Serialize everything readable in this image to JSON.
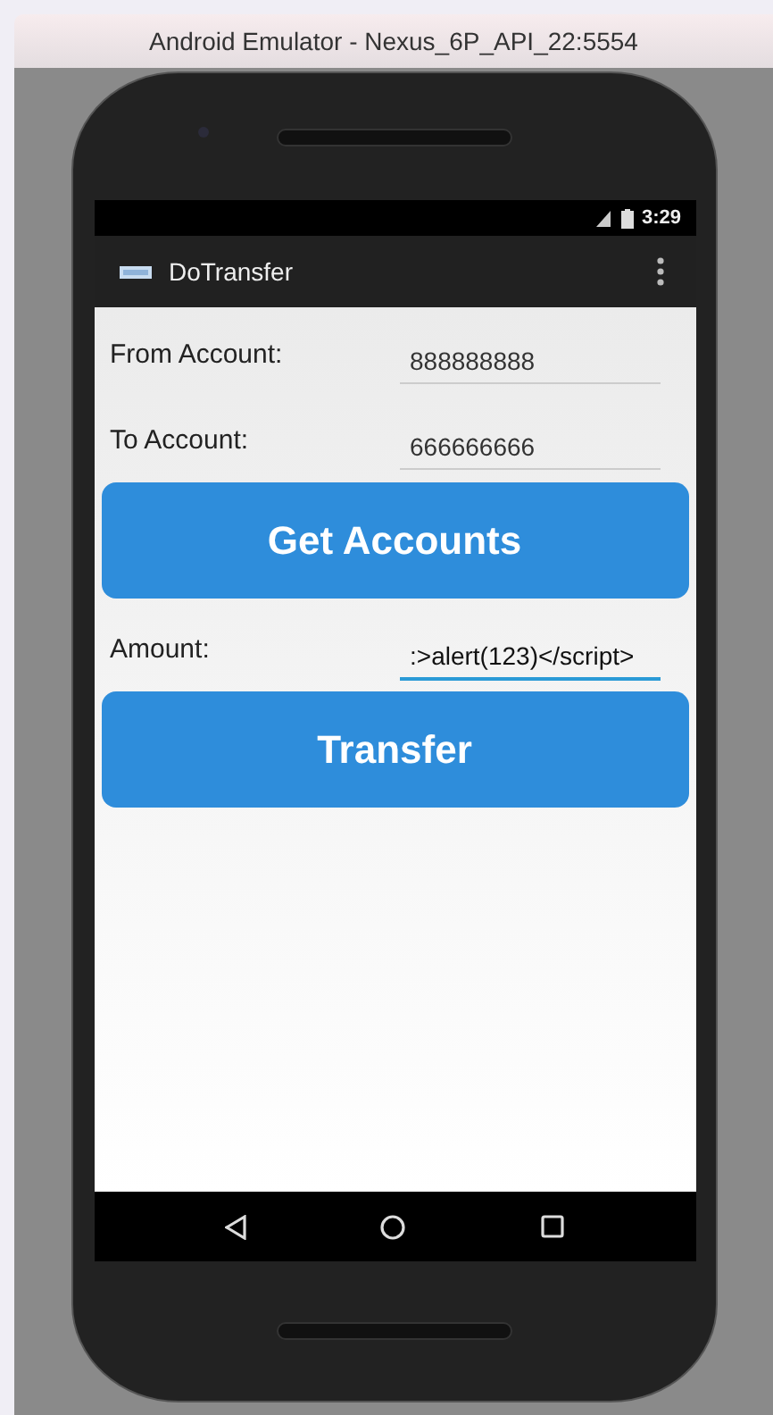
{
  "window": {
    "title": "Android Emulator - Nexus_6P_API_22:5554"
  },
  "status_bar": {
    "time": "3:29"
  },
  "app_bar": {
    "title": "DoTransfer"
  },
  "form": {
    "fields": [
      {
        "label": "From Account:",
        "value": "888888888",
        "focused": false
      },
      {
        "label": "To Account:",
        "value": "666666666",
        "focused": false
      },
      {
        "kind": "button",
        "label": "Get Accounts"
      },
      {
        "label": "Amount:",
        "value": ":>alert(123)</script>",
        "focused": true
      },
      {
        "kind": "button",
        "label": "Transfer"
      }
    ]
  }
}
